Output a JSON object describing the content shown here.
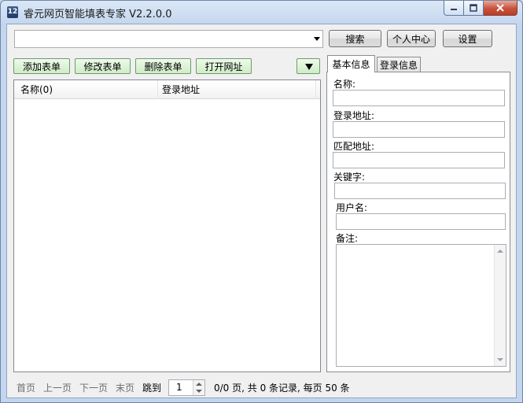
{
  "window": {
    "title": "睿元网页智能填表专家 V2.2.0.0",
    "icon_text": "12"
  },
  "toolbar": {
    "url_value": "",
    "search_label": "搜索",
    "user_center_label": "个人中心",
    "settings_label": "设置"
  },
  "form_actions": {
    "add_label": "添加表单",
    "edit_label": "修改表单",
    "delete_label": "删除表单",
    "open_label": "打开网址"
  },
  "list": {
    "columns": [
      "名称(0)",
      "登录地址"
    ],
    "rows": []
  },
  "tabs": [
    "基本信息",
    "登录信息"
  ],
  "detail": {
    "name_label": "名称:",
    "login_url_label": "登录地址:",
    "match_url_label": "匹配地址:",
    "keyword_label": "关键字:",
    "username_label": "用户名:",
    "note_label": "备注:"
  },
  "pager": {
    "first": "首页",
    "prev": "上一页",
    "next": "下一页",
    "last": "末页",
    "jump": "跳到",
    "page_value": "1",
    "summary": "0/0 页, 共 0 条记录, 每页 50 条"
  },
  "icons": [
    "app-icon",
    "minimize-icon",
    "maximize-icon",
    "close-icon",
    "dropdown-arrow-icon",
    "triangle-down-icon",
    "scroll-up-icon",
    "scroll-down-icon",
    "spin-up-icon",
    "spin-down-icon"
  ]
}
